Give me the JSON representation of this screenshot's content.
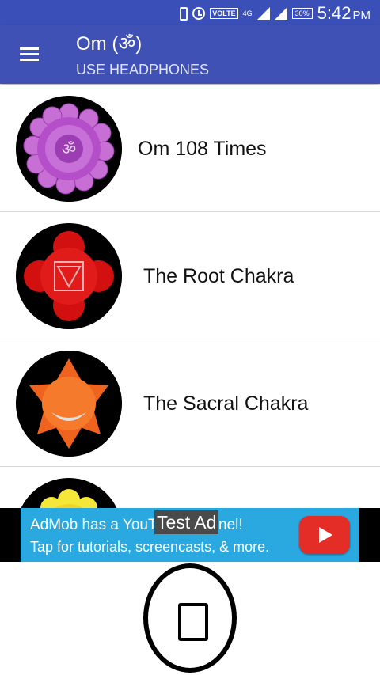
{
  "status_bar": {
    "network_badge": "VOLTE",
    "network_type": "4G",
    "battery": "30%",
    "time": "5:42",
    "ampm": "PM"
  },
  "app_bar": {
    "title": "Om (ॐ)",
    "subtitle": "USE HEADPHONES"
  },
  "items": [
    {
      "label": "Om 108 Times",
      "icon": "om-sahasrara-icon"
    },
    {
      "label": "The Root Chakra",
      "icon": "root-chakra-icon"
    },
    {
      "label": "The Sacral Chakra",
      "icon": "sacral-chakra-icon"
    },
    {
      "label": "",
      "icon": "solar-plexus-chakra-icon"
    }
  ],
  "ad": {
    "line1": "AdMob has a YouTube channel!",
    "line2": "Tap for tutorials, screencasts, & more.",
    "badge": "Test Ad",
    "icon": "youtube-play-icon"
  },
  "colors": {
    "status_bar": "#3a50b8",
    "app_bar": "#3f51b5",
    "ad_background": "#29a9e0",
    "youtube_red": "#e52d27"
  }
}
